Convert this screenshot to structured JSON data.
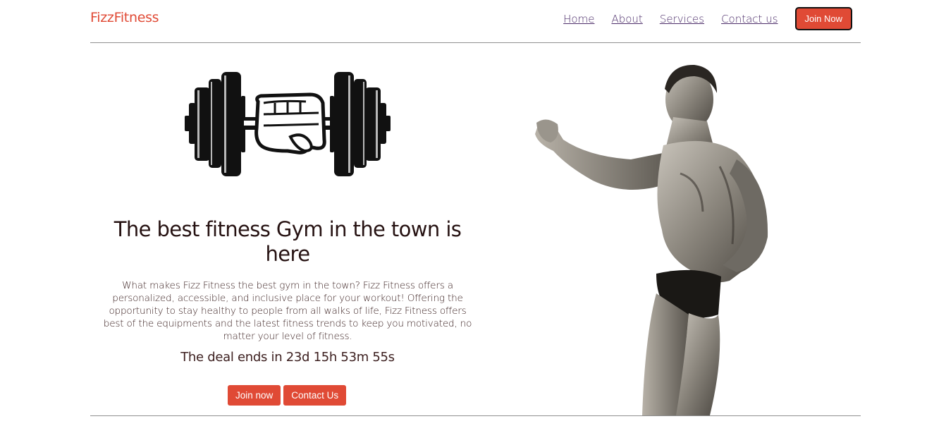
{
  "header": {
    "brand": "FizzFitness",
    "nav": [
      "Home",
      "About",
      "Services",
      "Contact us"
    ],
    "join_label": "Join Now"
  },
  "hero": {
    "headline": "The best fitness Gym in the town is here",
    "description": "What makes Fizz Fitness the best gym in the town? Fizz Fitness offers a personalized, accessible, and inclusive place for your workout! Offering the opportunity to stay healthy to people from all walks of life, Fizz Fitness offers best of the equipments and the latest fitness trends to keep you motivated, no matter your level of fitness.",
    "deal": "The deal ends in 23d 15h 53m 55s",
    "primary_label": "Join now",
    "secondary_label": "Contact Us"
  },
  "colors": {
    "accent": "#e04a35",
    "link": "#4b2c69",
    "text": "#261212"
  },
  "icons": {
    "logo_graphic": "dumbbell-fist-icon",
    "hero_image": "bodybuilder-image"
  }
}
